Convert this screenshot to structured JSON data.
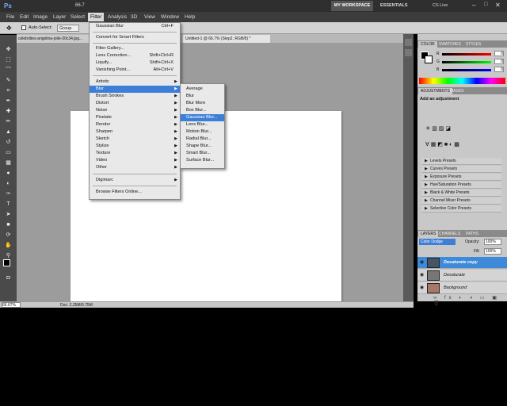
{
  "app": {
    "logo": "Ps",
    "zoom": "66.7",
    "workspace_btn": "MY WORKSPACE",
    "essentials": "ESSENTIALS",
    "cs_live": "CS Live"
  },
  "menubar": [
    "File",
    "Edit",
    "Image",
    "Layer",
    "Select",
    "Filter",
    "Analysis",
    "3D",
    "View",
    "Window",
    "Help"
  ],
  "options": {
    "auto_select": "Auto-Select:",
    "auto_select_value": "Group"
  },
  "doc_tabs": [
    "celebrities-angelina-jolie-30c34.jpg...",
    "Untitled-1 @ 66.7% (Step2, RGB/8) *"
  ],
  "filter_menu": {
    "items": [
      {
        "label": "Gaussian Blur",
        "shortcut": "Ctrl+F"
      },
      {
        "label": "Convert for Smart Filters"
      },
      {
        "label": "Filter Gallery..."
      },
      {
        "label": "Lens Correction...",
        "shortcut": "Shift+Ctrl+R"
      },
      {
        "label": "Liquify...",
        "shortcut": "Shift+Ctrl+X"
      },
      {
        "label": "Vanishing Point...",
        "shortcut": "Alt+Ctrl+V"
      },
      {
        "label": "Artistic",
        "arrow": "▶"
      },
      {
        "label": "Blur",
        "arrow": "▶"
      },
      {
        "label": "Brush Strokes",
        "arrow": "▶"
      },
      {
        "label": "Distort",
        "arrow": "▶"
      },
      {
        "label": "Noise",
        "arrow": "▶"
      },
      {
        "label": "Pixelate",
        "arrow": "▶"
      },
      {
        "label": "Render",
        "arrow": "▶"
      },
      {
        "label": "Sharpen",
        "arrow": "▶"
      },
      {
        "label": "Sketch",
        "arrow": "▶"
      },
      {
        "label": "Stylize",
        "arrow": "▶"
      },
      {
        "label": "Texture",
        "arrow": "▶"
      },
      {
        "label": "Video",
        "arrow": "▶"
      },
      {
        "label": "Other",
        "arrow": "▶"
      },
      {
        "label": "Digimarc",
        "arrow": "▶"
      },
      {
        "label": "Browse Filters Online..."
      }
    ]
  },
  "blur_menu": [
    "Average",
    "Blur",
    "Blur More",
    "Box Blur...",
    "Gaussian Blur...",
    "Lens Blur...",
    "Motion Blur...",
    "Radial Blur...",
    "Shape Blur...",
    "Smart Blur...",
    "Surface Blur..."
  ],
  "panels": {
    "color_tabs": [
      "COLOR",
      "SWATCHES",
      "STYLES"
    ],
    "color_channels": [
      "R",
      "G",
      "B"
    ],
    "color_values": [
      "0",
      "0",
      "0"
    ],
    "adjust_tabs": [
      "ADJUSTMENTS",
      "MASKS"
    ],
    "adjust_title": "Add an adjustment",
    "presets": [
      "Levels Presets",
      "Curves Presets",
      "Exposure Presets",
      "Hue/Saturation Presets",
      "Black & White Presets",
      "Channel Mixer Presets",
      "Selective Color Presets"
    ],
    "layer_tabs": [
      "LAYERS",
      "CHANNELS",
      "PATHS"
    ],
    "blend_mode": "Color Dodge",
    "opacity_label": "Opacity:",
    "opacity": "100%",
    "fill_label": "Fill:",
    "fill": "100%",
    "layers": [
      "Desaturate copy",
      "Desaturate",
      "Background"
    ]
  },
  "status": {
    "zoom": "66.67%",
    "doc": "Doc: 2.25M/6.75M"
  },
  "colors": {
    "accent": "#3d7fd7",
    "canvas": "#ffffff",
    "workspace": "#9c9c9c"
  }
}
